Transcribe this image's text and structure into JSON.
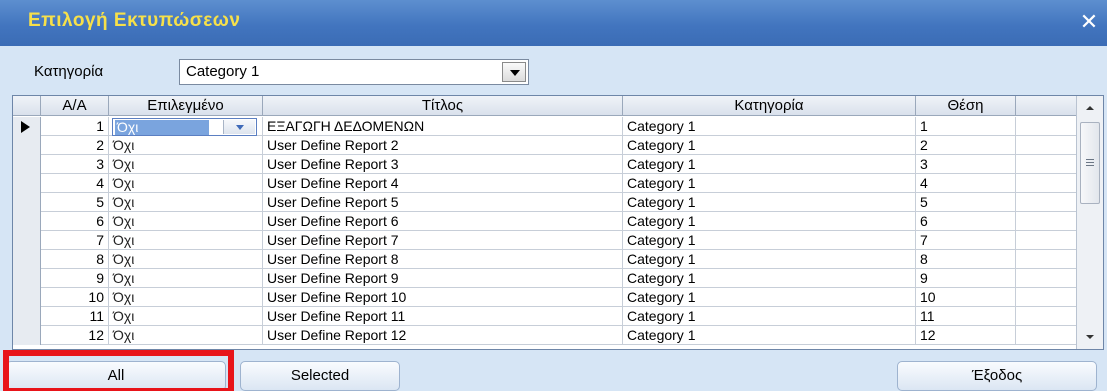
{
  "window": {
    "title": "Επιλογή Εκτυπώσεων",
    "close_glyph": "✕",
    "close_icon": "close-icon"
  },
  "filter": {
    "label": "Κατηγορία",
    "value": "Category 1"
  },
  "grid": {
    "columns": [
      "Α/Α",
      "Επιλεγμένο",
      "Τίτλος",
      "Κατηγορία",
      "Θέση"
    ],
    "rows": [
      {
        "aa": "1",
        "selected": "Όχι",
        "title": "ΕΞΑΓΩΓΗ ΔΕΔΟΜΕΝΩΝ",
        "category": "Category 1",
        "position": "1"
      },
      {
        "aa": "2",
        "selected": "Όχι",
        "title": "User Define Report 2",
        "category": "Category 1",
        "position": "2"
      },
      {
        "aa": "3",
        "selected": "Όχι",
        "title": "User Define Report 3",
        "category": "Category 1",
        "position": "3"
      },
      {
        "aa": "4",
        "selected": "Όχι",
        "title": "User Define Report 4",
        "category": "Category 1",
        "position": "4"
      },
      {
        "aa": "5",
        "selected": "Όχι",
        "title": "User Define Report 5",
        "category": "Category 1",
        "position": "5"
      },
      {
        "aa": "6",
        "selected": "Όχι",
        "title": "User Define Report 6",
        "category": "Category 1",
        "position": "6"
      },
      {
        "aa": "7",
        "selected": "Όχι",
        "title": "User Define Report 7",
        "category": "Category 1",
        "position": "7"
      },
      {
        "aa": "8",
        "selected": "Όχι",
        "title": "User Define Report 8",
        "category": "Category 1",
        "position": "8"
      },
      {
        "aa": "9",
        "selected": "Όχι",
        "title": "User Define Report 9",
        "category": "Category 1",
        "position": "9"
      },
      {
        "aa": "10",
        "selected": "Όχι",
        "title": "User Define Report 10",
        "category": "Category 1",
        "position": "10"
      },
      {
        "aa": "11",
        "selected": "Όχι",
        "title": "User Define Report 11",
        "category": "Category 1",
        "position": "11"
      },
      {
        "aa": "12",
        "selected": "Όχι",
        "title": "User Define Report 12",
        "category": "Category 1",
        "position": "12"
      }
    ],
    "current_row": 1
  },
  "buttons": {
    "all": "All",
    "selected": "Selected",
    "exit": "Έξοδος"
  },
  "colors": {
    "title_text": "#f6e04a",
    "titlebar": "#4275bf",
    "highlight": "#e8141a"
  }
}
